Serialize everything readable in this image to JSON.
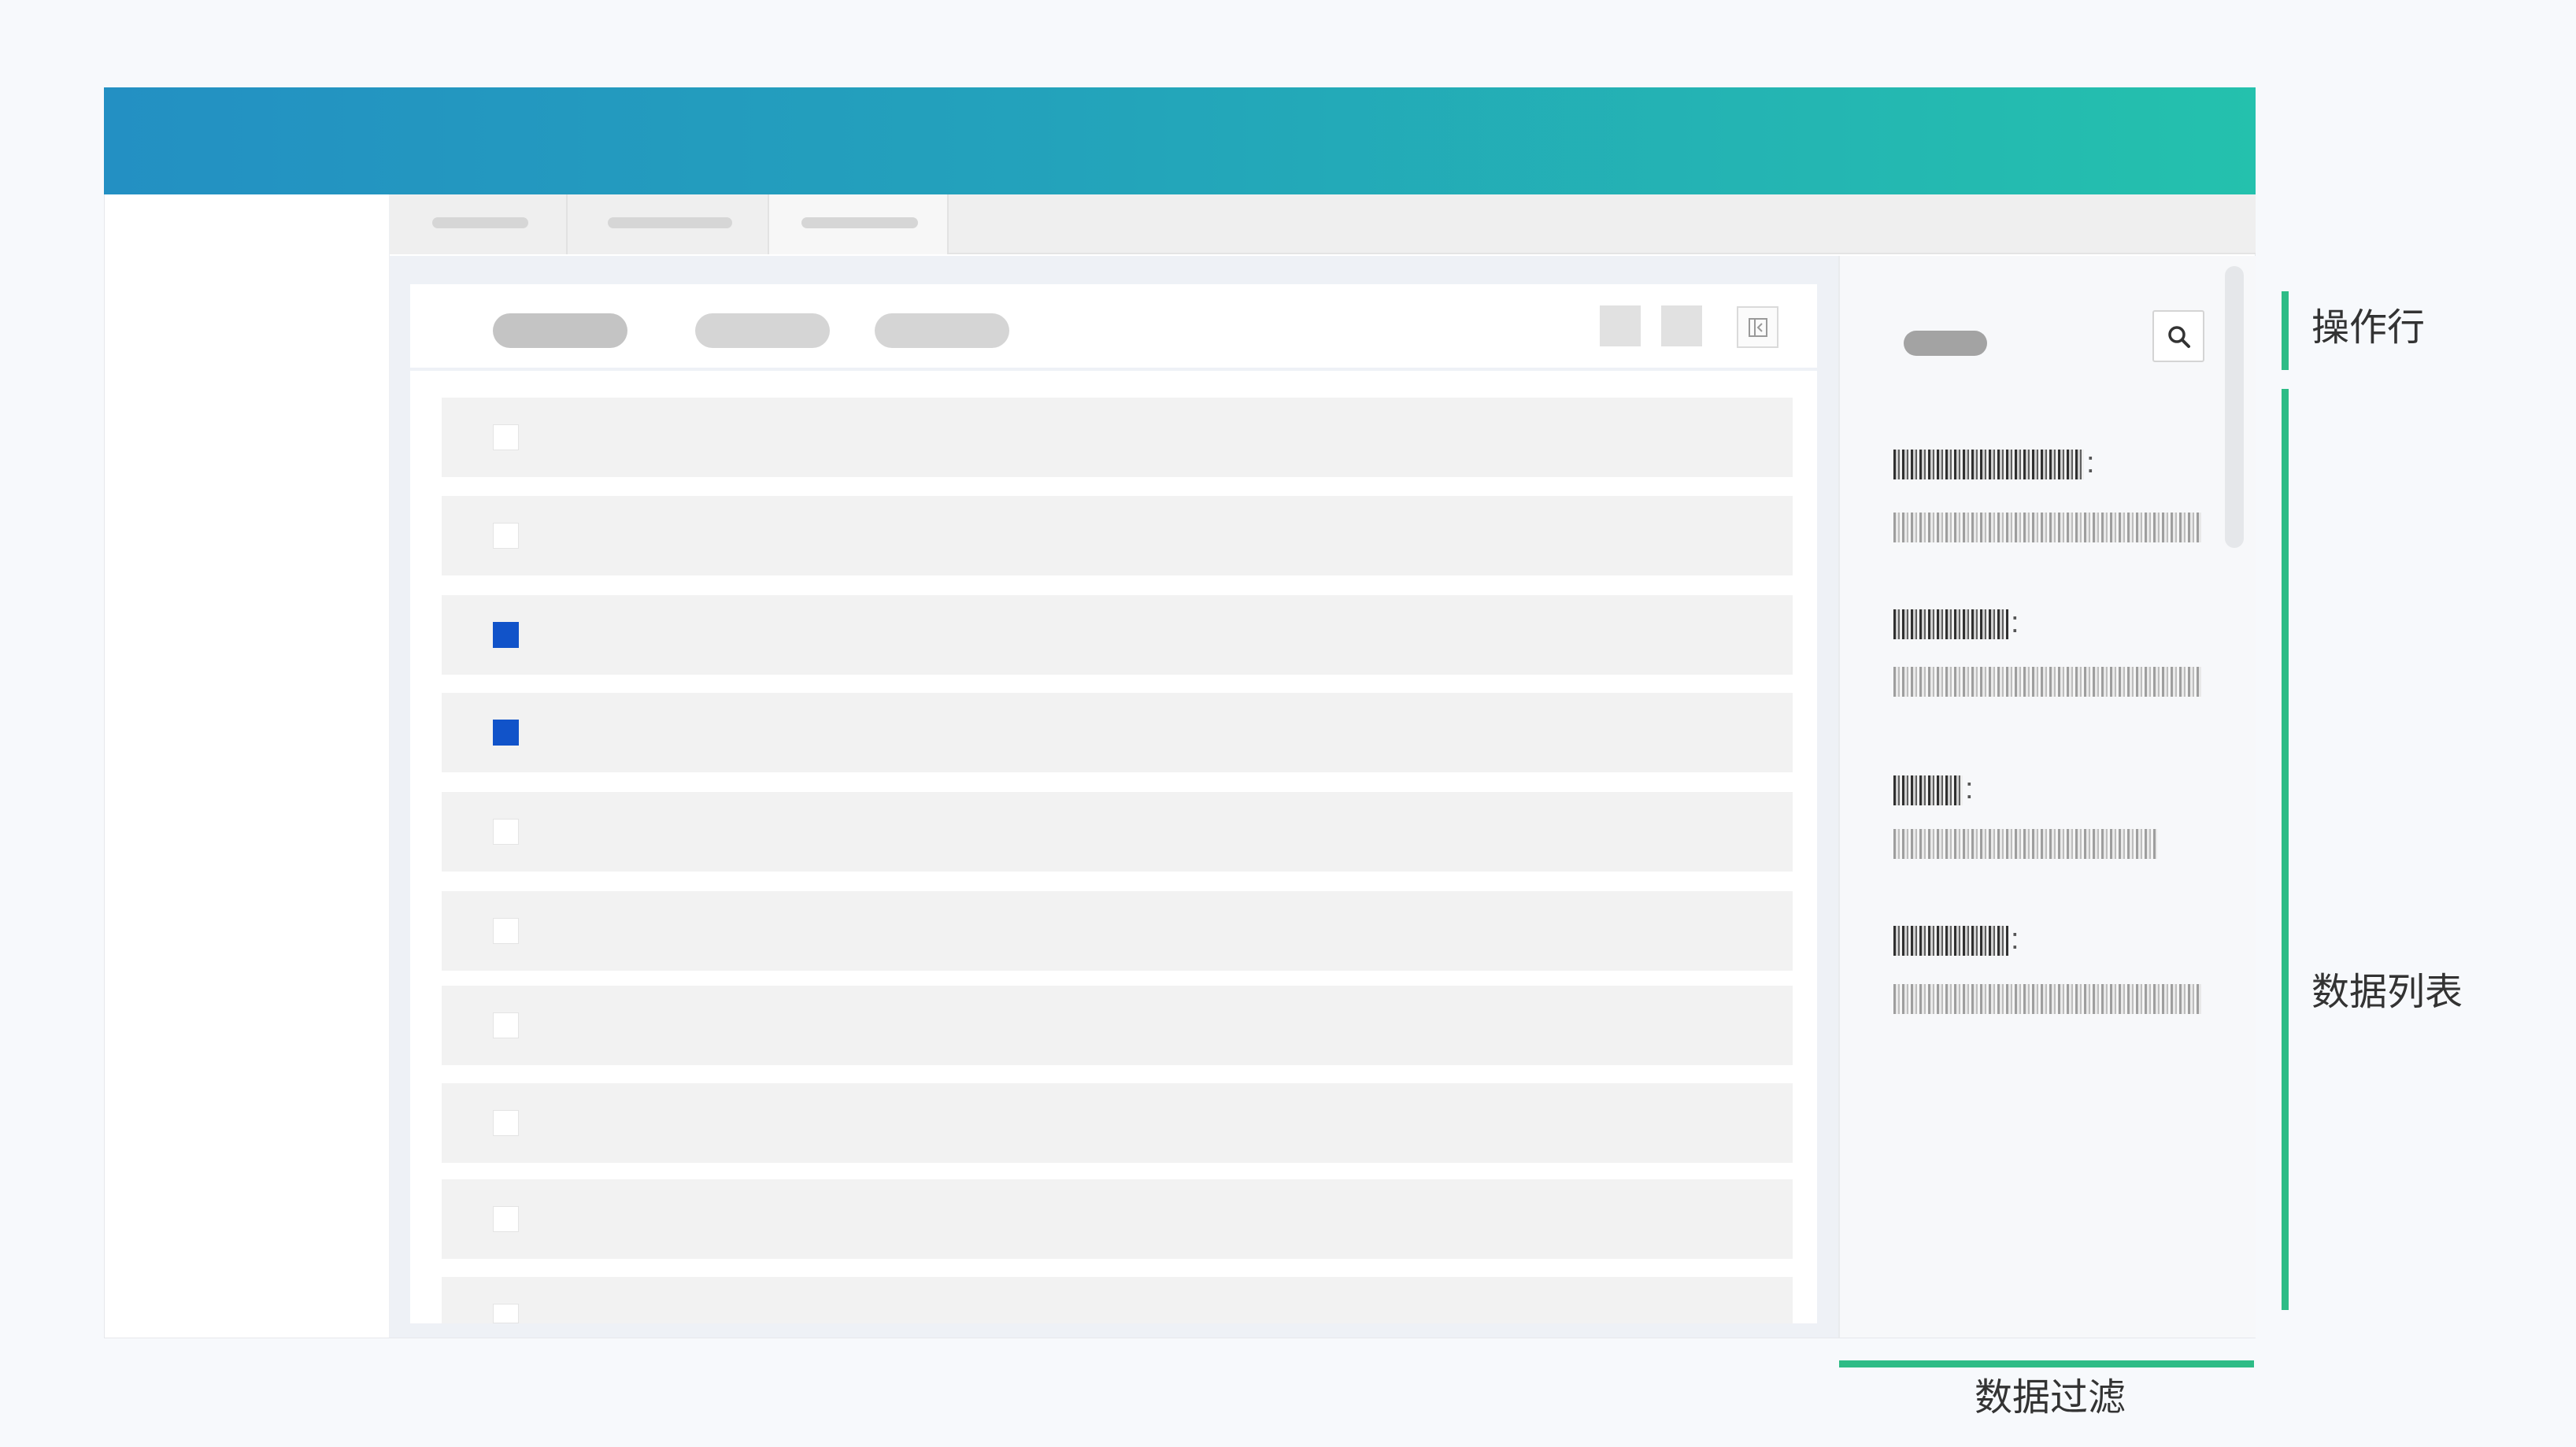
{
  "annotations": {
    "action_row": "操作行",
    "data_list": "数据列表",
    "data_filter": "数据过滤"
  },
  "colors": {
    "header_gradient_start": "#2390c3",
    "header_gradient_end": "#24c1ad",
    "checkbox_checked": "#1153c9",
    "annotation_bracket": "#2ebc86"
  },
  "tabs": [
    {
      "state": "inactive"
    },
    {
      "state": "inactive"
    },
    {
      "state": "active"
    }
  ],
  "list": {
    "rows": [
      {
        "checked": false
      },
      {
        "checked": false
      },
      {
        "checked": true
      },
      {
        "checked": true
      },
      {
        "checked": false
      },
      {
        "checked": false
      },
      {
        "checked": false
      },
      {
        "checked": false
      },
      {
        "checked": false
      },
      {
        "checked": false
      }
    ]
  },
  "toolbar": {
    "icons": [
      "placeholder-square-icon",
      "placeholder-square-icon",
      "collapse-panel-icon"
    ]
  },
  "filter": {
    "search_icon": "search-icon",
    "fields": [
      {
        "colon": ":"
      },
      {
        "colon": ":"
      },
      {
        "colon": ":"
      },
      {
        "colon": ":"
      }
    ]
  }
}
